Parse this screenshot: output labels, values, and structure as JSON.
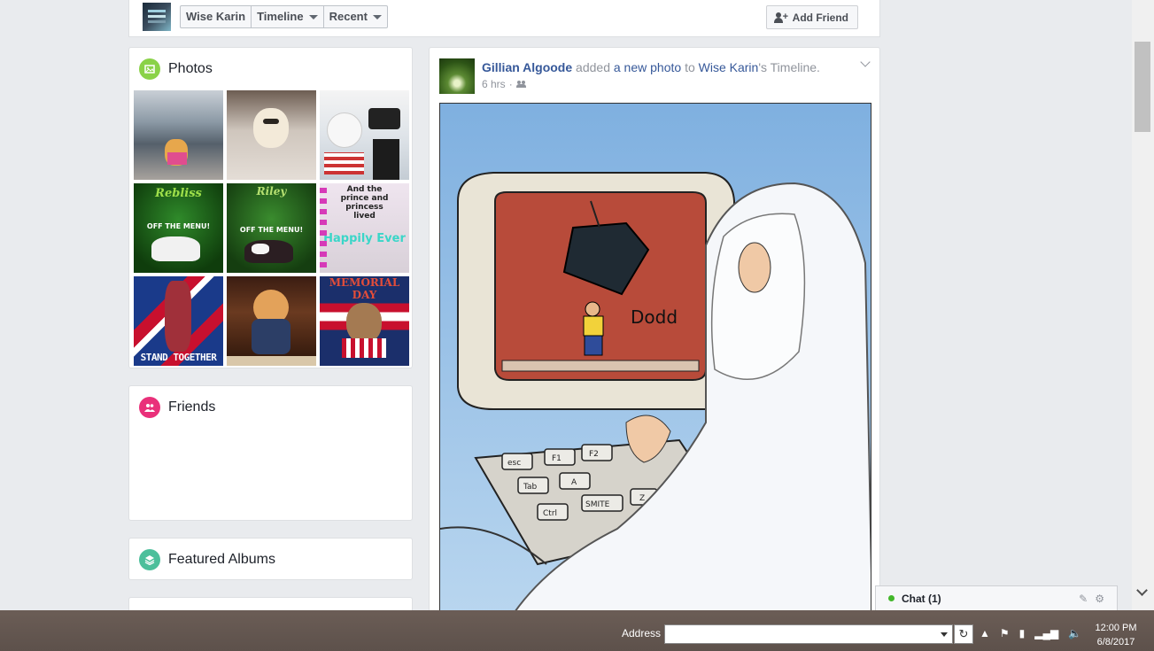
{
  "header": {
    "breadcrumbs": [
      "Wise Karin",
      "Timeline",
      "Recent"
    ],
    "add_friend_label": "Add Friend"
  },
  "photos": {
    "title": "Photos",
    "tiles": [
      {
        "label": ""
      },
      {
        "label": ""
      },
      {
        "label": ""
      },
      {
        "label": "Rebliss"
      },
      {
        "label": "Riley"
      },
      {
        "label": "And the prince and princess lived"
      },
      {
        "label": "STAND TOGETHER"
      },
      {
        "label": ""
      },
      {
        "label": "MEMORIAL DAY"
      }
    ],
    "tile_subtext": "OFF THE MENU!",
    "tile_subtext2": "Happily Ever"
  },
  "friends": {
    "title": "Friends"
  },
  "albums": {
    "title": "Featured Albums"
  },
  "post": {
    "author": "Gillian Algoode",
    "action_text": "added",
    "object_link": "a new photo",
    "to_text": "to",
    "target": "Wise Karin",
    "target_suffix": "'s Timeline.",
    "time": "6 hrs",
    "separator": "·",
    "image_caption": "Dodd",
    "keys": [
      "esc",
      "F1",
      "F2",
      "Tab",
      "A",
      "SMITE",
      "Z",
      "Ctrl"
    ]
  },
  "chat": {
    "label": "Chat (1)"
  },
  "taskbar": {
    "address_label": "Address",
    "address_value": "",
    "time": "12:00 PM",
    "date": "6/8/2017"
  }
}
